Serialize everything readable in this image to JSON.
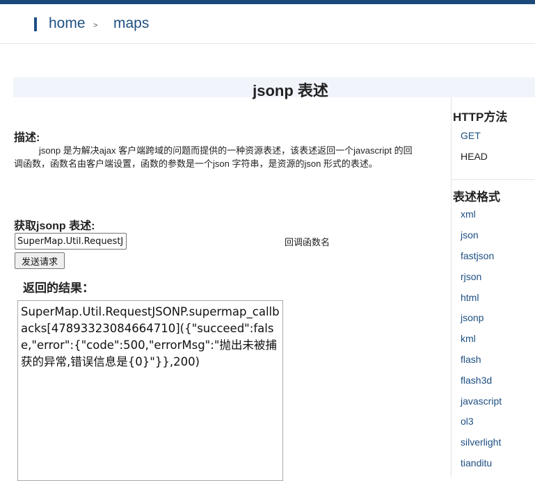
{
  "nav": {
    "home": "home",
    "separator": ">",
    "maps": "maps"
  },
  "page_title": "jsonp 表述",
  "description": {
    "heading": "描述:",
    "text": "jsonp 是为解决ajax 客户端跨域的问题而提供的一种资源表述，该表述返回一个javascript 的回调函数，函数名由客户端设置，函数的参数是一个json 字符串，是资源的json 形式的表述。"
  },
  "request": {
    "heading": "获取jsonp 表述:",
    "callback_value": "SuperMap.Util.RequestJSONP.supermap_callbacks",
    "callback_label": "回调函数名",
    "send_label": "发送请求"
  },
  "result": {
    "heading": "返回的结果：",
    "text": "SuperMap.Util.RequestJSONP.supermap_callbacks[47893323084664710]({\"succeed\":false,\"error\":{\"code\":500,\"errorMsg\":\"抛出未被捕获的异常,错误信息是{0}\"}},200)"
  },
  "sidebar": {
    "http_heading": "HTTP方法",
    "http_methods": [
      "GET",
      "HEAD"
    ],
    "formats_heading": "表述格式",
    "formats": [
      "xml",
      "json",
      "fastjson",
      "rjson",
      "html",
      "jsonp",
      "kml",
      "flash",
      "flash3d",
      "javascript",
      "ol3",
      "silverlight",
      "tianditu"
    ]
  }
}
